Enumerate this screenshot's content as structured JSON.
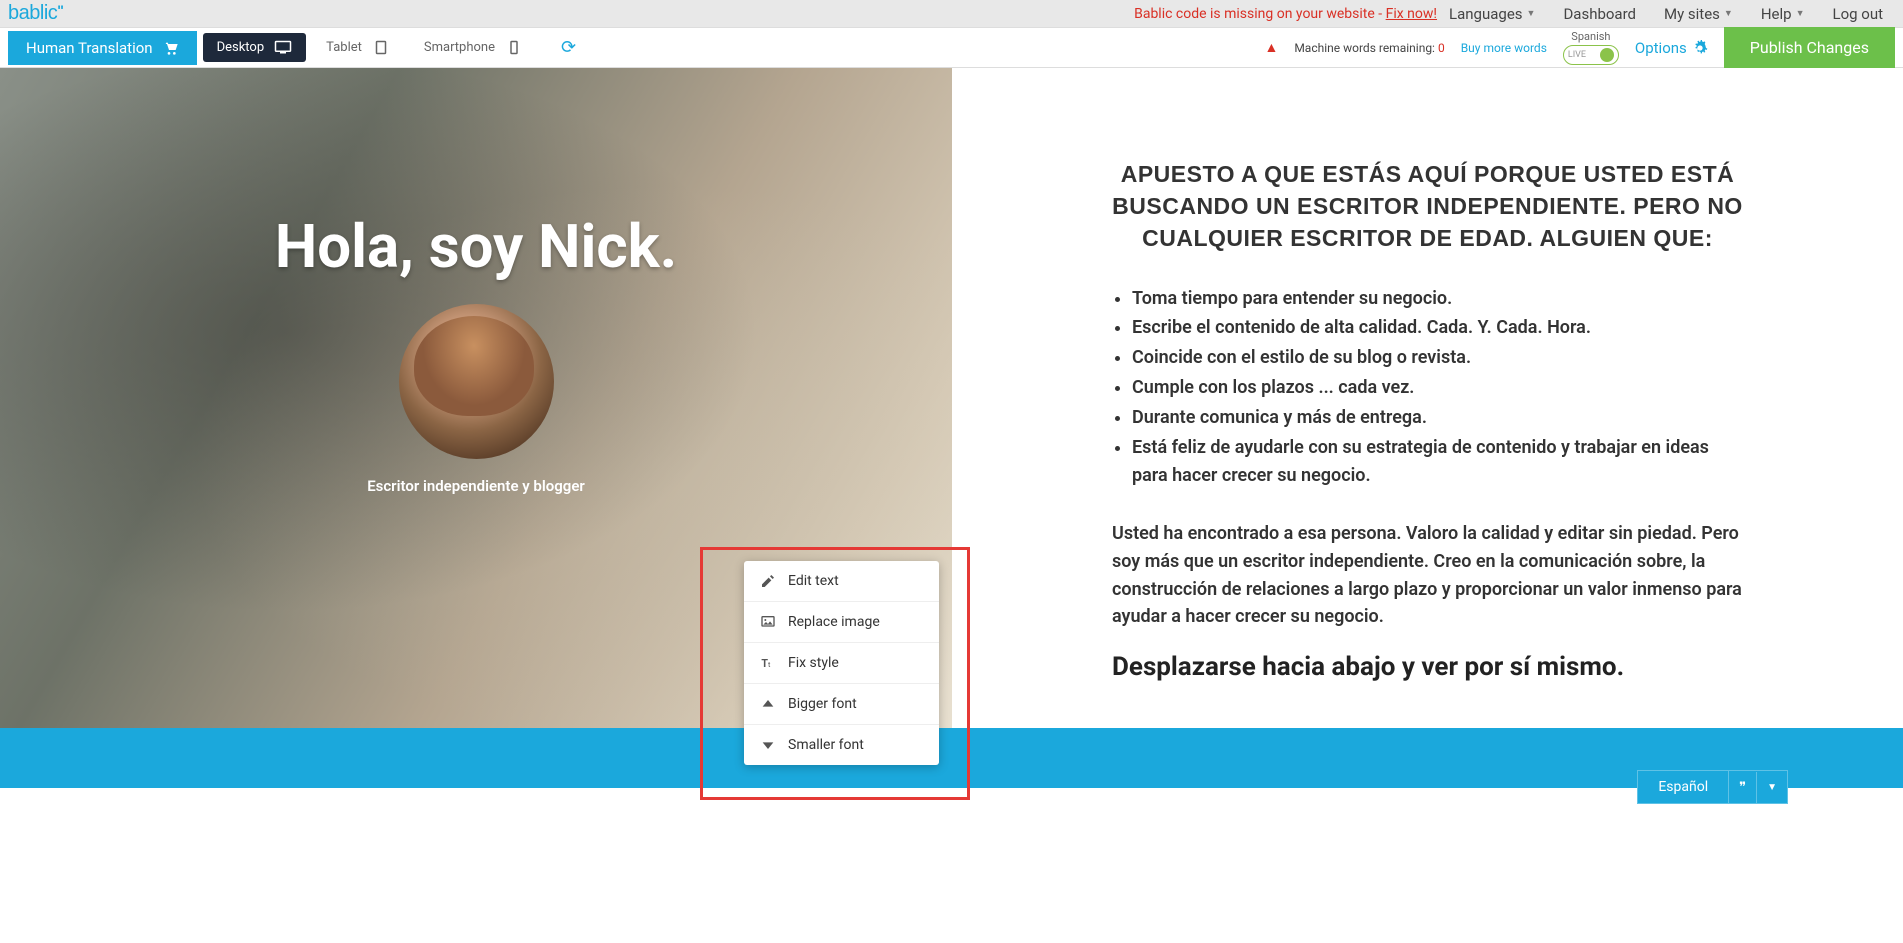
{
  "topbar": {
    "logo": "bablic",
    "alert_prefix": "Bablic code is missing on your website - ",
    "alert_link": "Fix now!",
    "nav": [
      "Languages",
      "Dashboard",
      "My sites",
      "Help",
      "Log out"
    ]
  },
  "toolbar": {
    "human_translation": "Human Translation",
    "devices": {
      "desktop": "Desktop",
      "tablet": "Tablet",
      "smartphone": "Smartphone"
    },
    "words_label": "Machine words remaining:",
    "words_count": "0",
    "buy_more": "Buy more words",
    "lang_toggle_label": "Spanish",
    "lang_toggle_state": "LIVE",
    "options": "Options",
    "publish": "Publish Changes"
  },
  "hero": {
    "title": "Hola, soy Nick.",
    "subtitle": "Escritor independiente y blogger"
  },
  "context_menu": {
    "edit_text": "Edit text",
    "replace_image": "Replace image",
    "fix_style": "Fix style",
    "bigger_font": "Bigger font",
    "smaller_font": "Smaller font"
  },
  "right": {
    "heading": "APUESTO A QUE ESTÁS AQUÍ PORQUE USTED ESTÁ BUSCANDO UN ESCRITOR INDEPENDIENTE. PERO NO CUALQUIER ESCRITOR DE EDAD. ALGUIEN QUE:",
    "bullets": [
      "Toma tiempo para entender su negocio.",
      "Escribe el contenido de alta calidad. Cada. Y. Cada. Hora.",
      "Coincide con el estilo de su blog o revista.",
      "Cumple con los plazos ... cada vez.",
      "Durante comunica y más de entrega.",
      "Está feliz de ayudarle con su estrategia de contenido y trabajar en ideas para hacer crecer su negocio."
    ],
    "para": "Usted ha encontrado a esa persona. Valoro la calidad y editar sin piedad. Pero soy más que un escritor independiente. Creo en la comunicación sobre, la construcción de relaciones a largo plazo y proporcionar un valor inmenso para ayudar a hacer crecer su negocio.",
    "cta": "Desplazarse hacia abajo y ver por sí mismo."
  },
  "footer": {
    "lang": "Español",
    "quote": "❞"
  }
}
